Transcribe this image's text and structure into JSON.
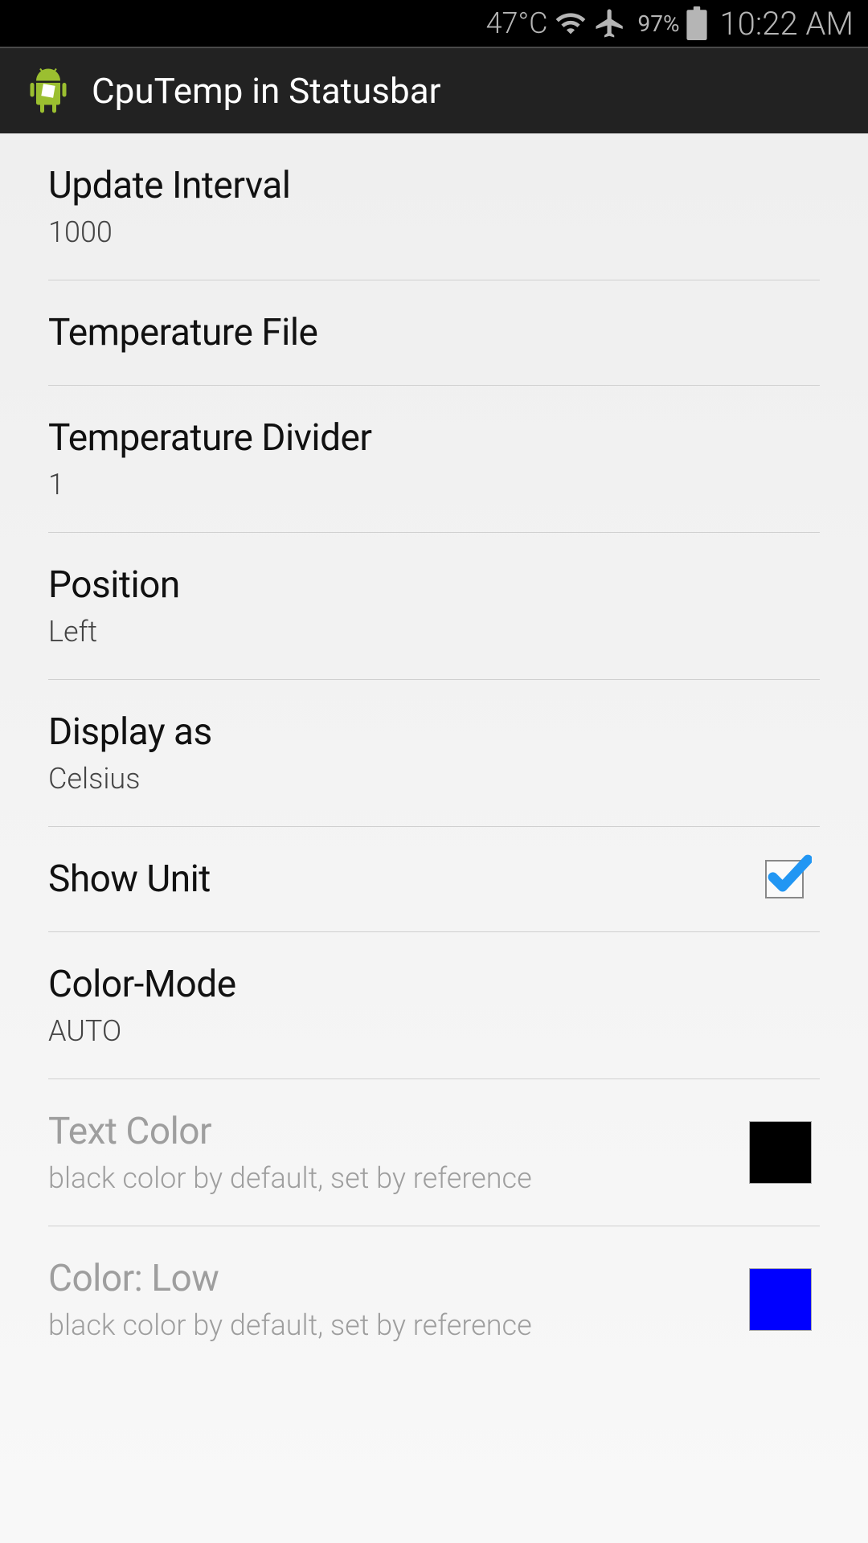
{
  "statusbar": {
    "temperature": "47°C",
    "battery_pct": "97%",
    "time": "10:22 AM"
  },
  "header": {
    "title": "CpuTemp in Statusbar"
  },
  "prefs": {
    "update_interval": {
      "title": "Update Interval",
      "summary": "1000"
    },
    "temp_file": {
      "title": "Temperature File"
    },
    "temp_divider": {
      "title": "Temperature Divider",
      "summary": "1"
    },
    "position": {
      "title": "Position",
      "summary": "Left"
    },
    "display_as": {
      "title": "Display as",
      "summary": "Celsius"
    },
    "show_unit": {
      "title": "Show Unit"
    },
    "color_mode": {
      "title": "Color-Mode",
      "summary": "AUTO"
    },
    "text_color": {
      "title": "Text Color",
      "summary": "black color by default, set by reference"
    },
    "color_low": {
      "title": "Color: Low",
      "summary": "black color by default, set by reference"
    }
  },
  "colors": {
    "text_color_swatch": "#000000",
    "color_low_swatch": "#0000FF"
  }
}
